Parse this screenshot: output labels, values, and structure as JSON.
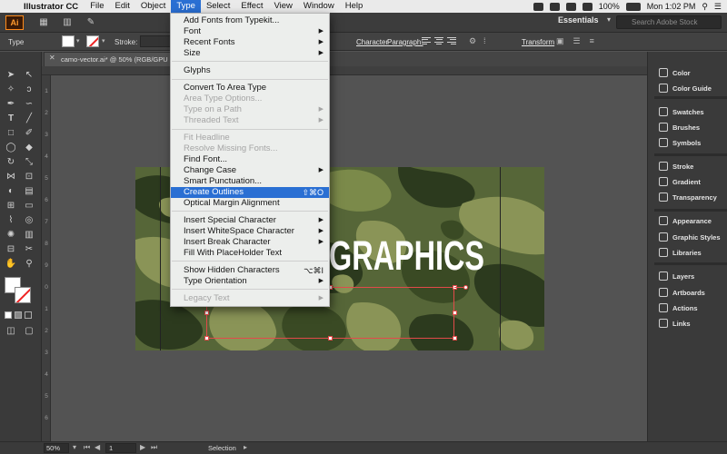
{
  "menubar": {
    "app_name": "Illustrator CC",
    "menus": [
      "File",
      "Edit",
      "Object",
      "Type",
      "Select",
      "Effect",
      "View",
      "Window",
      "Help"
    ],
    "battery": "100%",
    "clock": "Mon 1:02 PM"
  },
  "appbar": {
    "logo": "Ai",
    "workspace": "Essentials",
    "search_placeholder": "Search Adobe Stock"
  },
  "control_bar": {
    "tool_label": "Type",
    "stroke_label": "Stroke:",
    "character_link": "Character",
    "paragraph_link": "Paragraph:",
    "transform_link": "Transform"
  },
  "document": {
    "tab_title": "camo-vector.ai* @ 50% (RGB/GPU Previ",
    "headline_text": "GRAPHICS"
  },
  "rulers": {
    "left_numbers": [
      "1",
      "2",
      "3",
      "4",
      "5",
      "6",
      "7",
      "8",
      "9",
      "0",
      "1",
      "2",
      "3",
      "4",
      "5",
      "6"
    ]
  },
  "type_menu": {
    "items": [
      {
        "label": "Add Fonts from Typekit...",
        "enabled": true
      },
      {
        "label": "Font",
        "enabled": true,
        "submenu": true
      },
      {
        "label": "Recent Fonts",
        "enabled": true,
        "submenu": true
      },
      {
        "label": "Size",
        "enabled": true,
        "submenu": true
      },
      {
        "label": "Glyphs",
        "enabled": true
      },
      {
        "label": "Convert To Area Type",
        "enabled": true
      },
      {
        "label": "Area Type Options...",
        "enabled": false
      },
      {
        "label": "Type on a Path",
        "enabled": false,
        "submenu": true
      },
      {
        "label": "Threaded Text",
        "enabled": false,
        "submenu": true
      },
      {
        "label": "Fit Headline",
        "enabled": false
      },
      {
        "label": "Resolve Missing Fonts...",
        "enabled": false
      },
      {
        "label": "Find Font...",
        "enabled": true
      },
      {
        "label": "Change Case",
        "enabled": true,
        "submenu": true
      },
      {
        "label": "Smart Punctuation...",
        "enabled": true
      },
      {
        "label": "Create Outlines",
        "enabled": true,
        "highlighted": true,
        "shortcut": "⇧⌘O"
      },
      {
        "label": "Optical Margin Alignment",
        "enabled": true
      },
      {
        "label": "Insert Special Character",
        "enabled": true,
        "submenu": true
      },
      {
        "label": "Insert WhiteSpace Character",
        "enabled": true,
        "submenu": true
      },
      {
        "label": "Insert Break Character",
        "enabled": true,
        "submenu": true
      },
      {
        "label": "Fill With PlaceHolder Text",
        "enabled": true
      },
      {
        "label": "Show Hidden Characters",
        "enabled": true,
        "shortcut": "⌥⌘I"
      },
      {
        "label": "Type Orientation",
        "enabled": true,
        "submenu": true
      },
      {
        "label": "Legacy Text",
        "enabled": false,
        "submenu": true
      }
    ]
  },
  "panels": {
    "items": [
      "Color",
      "Color Guide",
      "Swatches",
      "Brushes",
      "Symbols",
      "Stroke",
      "Gradient",
      "Transparency",
      "Appearance",
      "Graphic Styles",
      "Libraries",
      "Layers",
      "Artboards",
      "Actions",
      "Links"
    ]
  },
  "statusbar": {
    "zoom": "50%",
    "page": "1",
    "status": "Selection"
  },
  "colors": {
    "menu_highlight": "#2a6fd3",
    "selection_red": "#e24a4a",
    "camo_dark": "#2c3a1e",
    "camo_mid": "#5d6d3b",
    "camo_light": "#8a9457"
  }
}
